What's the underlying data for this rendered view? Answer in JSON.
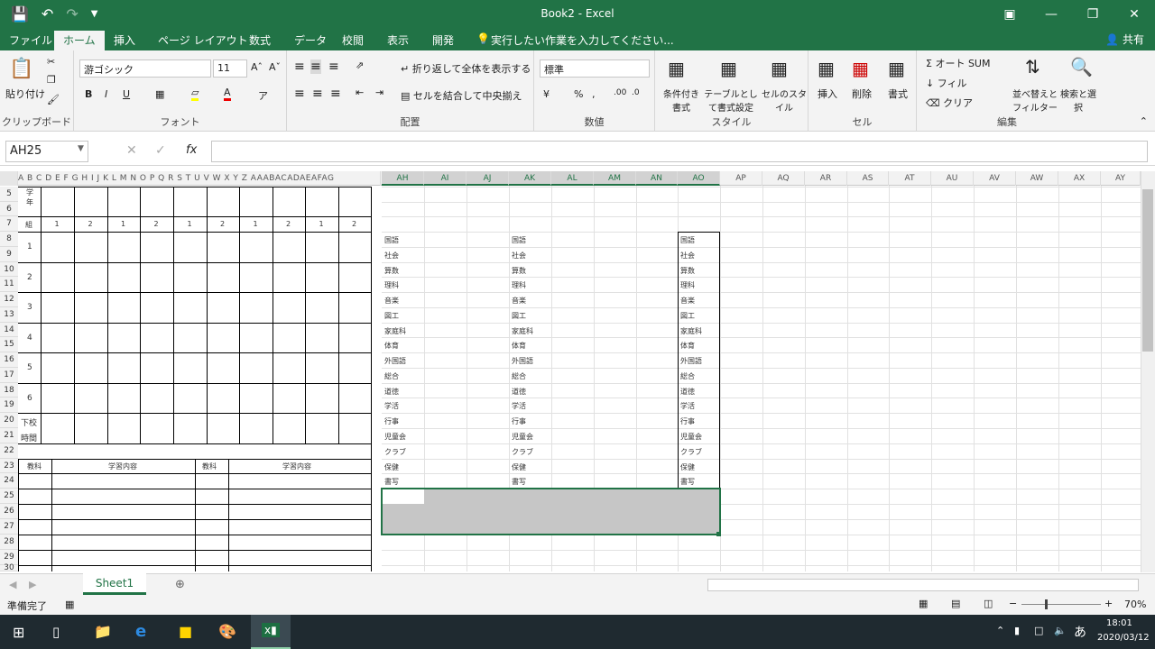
{
  "window": {
    "title": "Book2 - Excel"
  },
  "quick_access": [
    "save-icon",
    "undo-icon",
    "redo-icon",
    "customize-icon"
  ],
  "ribbon_tabs": [
    "ファイル",
    "ホーム",
    "挿入",
    "ページ レイアウト",
    "数式",
    "データ",
    "校閲",
    "表示",
    "開発",
    "実行したい作業を入力してください..."
  ],
  "share_label": "共有",
  "ribbon": {
    "clipboard": {
      "paste": "貼り付け",
      "group": "クリップボード"
    },
    "font": {
      "name": "游ゴシック",
      "size": "11",
      "group": "フォント"
    },
    "align": {
      "wrap": "折り返して全体を表示する",
      "merge": "セルを結合して中央揃え",
      "group": "配置"
    },
    "number": {
      "format": "標準",
      "group": "数値"
    },
    "styles": {
      "cond": "条件付き書式",
      "table": "テーブルとして書式設定",
      "cell": "セルのスタイル",
      "group": "スタイル"
    },
    "cells": {
      "insert": "挿入",
      "delete": "削除",
      "format": "書式",
      "group": "セル"
    },
    "edit": {
      "autosum": "オート SUM",
      "fill": "フィル",
      "clear": "クリア",
      "sort": "並べ替えとフィルター",
      "find": "検索と選択",
      "group": "編集"
    }
  },
  "namebox": "AH25",
  "columns_right": [
    "AH",
    "AI",
    "AJ",
    "AK",
    "AL",
    "AM",
    "AN",
    "AO",
    "AP",
    "AQ",
    "AR",
    "AS",
    "AT",
    "AU",
    "AV",
    "AW",
    "AX",
    "AY"
  ],
  "columns_left": "A B C D E F G H I J K L M N O P Q R S T U V W X Y Z AAABACADAEAFAG",
  "rows": [
    "5",
    "6",
    "7",
    "8",
    "9",
    "10",
    "11",
    "12",
    "13",
    "14",
    "15",
    "16",
    "17",
    "18",
    "19",
    "20",
    "21",
    "22",
    "23",
    "24",
    "25",
    "26",
    "27",
    "28",
    "29",
    "30"
  ],
  "left_table": {
    "group_label": "組",
    "group_nums": [
      "1",
      "2",
      "1",
      "2",
      "1",
      "2",
      "1",
      "2",
      "1",
      "2"
    ],
    "periods": [
      "1",
      "2",
      "3",
      "4",
      "5",
      "6"
    ],
    "afterschool": [
      "下校",
      "時間"
    ],
    "row5_top": "学",
    "row5_sub": "年",
    "bottom_headers": [
      "教科",
      "学習内容",
      "教科",
      "学習内容"
    ]
  },
  "subjects": [
    "国語",
    "社会",
    "算数",
    "理科",
    "音楽",
    "図工",
    "家庭科",
    "体育",
    "外国語",
    "総合",
    "道徳",
    "学活",
    "行事",
    "児童会",
    "クラブ",
    "保健",
    "書写"
  ],
  "sheet_tab": "Sheet1",
  "status": {
    "ready": "準備完了",
    "zoom": "70%"
  },
  "taskbar": {
    "time": "18:01",
    "date": "2020/03/12",
    "ime": "あ"
  }
}
